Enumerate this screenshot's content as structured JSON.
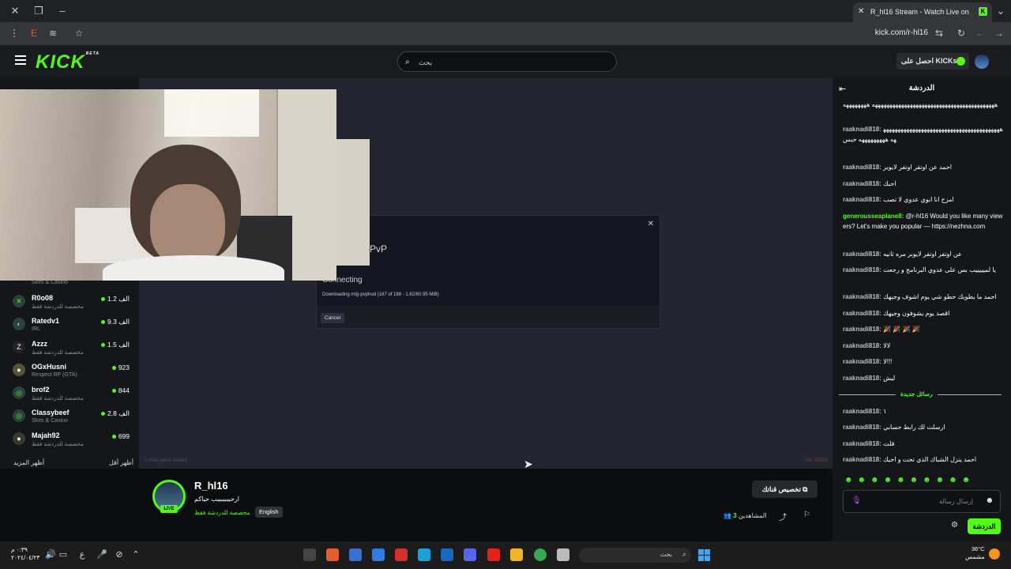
{
  "browser": {
    "tab_title": "R_hl16 Stream - Watch Live on",
    "tab_favicon": "K",
    "url": "kick.com/r-hl16"
  },
  "header": {
    "logo": "KICK",
    "logo_badge": "BETA",
    "search_placeholder": "بحث",
    "get_kicks": "احصل على KICKs"
  },
  "sidebar": {
    "items": [
      {
        "name": "",
        "category": "Slots & Casino",
        "viewers": ""
      },
      {
        "name": "R0o08",
        "category": "مخصصة للدردشة فقط",
        "viewers": "1.2 الف"
      },
      {
        "name": "Ratedv1",
        "category": "IRL",
        "viewers": "9.3 الف"
      },
      {
        "name": "Azzz",
        "category": "مخصصة للدردشة فقط",
        "viewers": "1.5 الف"
      },
      {
        "name": "OGxHusni",
        "category": "Respect RP (GTA)",
        "viewers": "923"
      },
      {
        "name": "brof2",
        "category": "مخصصة للدردشة فقط",
        "viewers": "844"
      },
      {
        "name": "Classybeef",
        "category": "Slots & Casino",
        "viewers": "2.8 الف"
      },
      {
        "name": "Majah92",
        "category": "مخصصة للدردشة فقط",
        "viewers": "699"
      }
    ],
    "show_more": "أظهر المزيد",
    "show_less": "أظهر أقل"
  },
  "player": {
    "dialog_title": "PvP",
    "dialog_status": "Connecting",
    "dialog_progress": "Downloading mtg-pvphud (187 of 188 - 1.62/60.95 MiB)",
    "dialog_cancel": "Cancel",
    "loaded_text": "2 mod packs loaded",
    "version_text": "Ver. 20955"
  },
  "stream_info": {
    "streamer": "R_hl16",
    "live_label": "LIVE",
    "title": "ارحبببببببب حياكم",
    "category": "مخصصة للدردشة فقط",
    "language": "English",
    "customize": "تخصيص قناتك",
    "viewers_label": "المشاهدين",
    "viewers_count": "3"
  },
  "chat": {
    "title": "الدردشة",
    "messages": [
      {
        "user": "",
        "text": "ههههههههههههههههههههههههههههههههههههههههههه ههههههههه"
      },
      {
        "user": "raaknadi818:",
        "text": "ههههههههههههههههههههههههههههههههههههههههههه هههههههههه حبس"
      },
      {
        "user": "raaknadi818:",
        "text": "احمد عن اوتفر اوتفر لايوبر"
      },
      {
        "user": "raaknadi818:",
        "text": "احبك"
      },
      {
        "user": "raaknadi818:",
        "text": "امزح انا ابوي عدوي لا تصب"
      },
      {
        "user": "generousseaplane8:",
        "text": "@r-hl16 Would you like many viewers? Let's make you popular — https://nezhna.com"
      },
      {
        "user": "raaknadi818:",
        "text": "عن اوتفر اوتفر لايوبر مره ثانيه"
      },
      {
        "user": "raaknadi818:",
        "text": "يا لميييييب بس على عدوي البرنامج و رجعت"
      },
      {
        "user": "raaknadi818:",
        "text": "احمد ما يطوبك حطو شي يوم اشوف وجيهك"
      },
      {
        "user": "raaknadi818:",
        "text": "اقصد يوم يشوفون وجيهك"
      },
      {
        "user": "raaknadi818:",
        "text": "🎉 🎉 🎉 🎉"
      },
      {
        "user": "raaknadi818:",
        "text": "لالا"
      },
      {
        "user": "raaknadi818:",
        "text": "لا!!!"
      },
      {
        "user": "raaknadi818:",
        "text": "ليش"
      }
    ],
    "new_messages_label": "رسائل جديدة",
    "new_messages": [
      {
        "user": "raaknadi818:",
        "text": "١"
      },
      {
        "user": "raaknadi818:",
        "text": "ارسلت لك رابط حسابي"
      },
      {
        "user": "raaknadi818:",
        "text": "قلت"
      },
      {
        "user": "raaknadi818:",
        "text": "احمد ينزل الشباك الذي تحت و احيك"
      }
    ],
    "emotes": "☻☻☻☻☻☻☻☻☻☻",
    "input_placeholder": "إرسال رسالة",
    "send_label": "الدردشة"
  },
  "taskbar": {
    "time": "٠:٣٩ م",
    "date": "٢٠٢٤/٠٤/٢٣",
    "lang": "ع",
    "search_placeholder": "بحث",
    "temperature": "36°C",
    "weather": "مشمس"
  },
  "colors": {
    "accent": "#53fc18",
    "chrome": "#202124",
    "player_bg": "#232631"
  }
}
